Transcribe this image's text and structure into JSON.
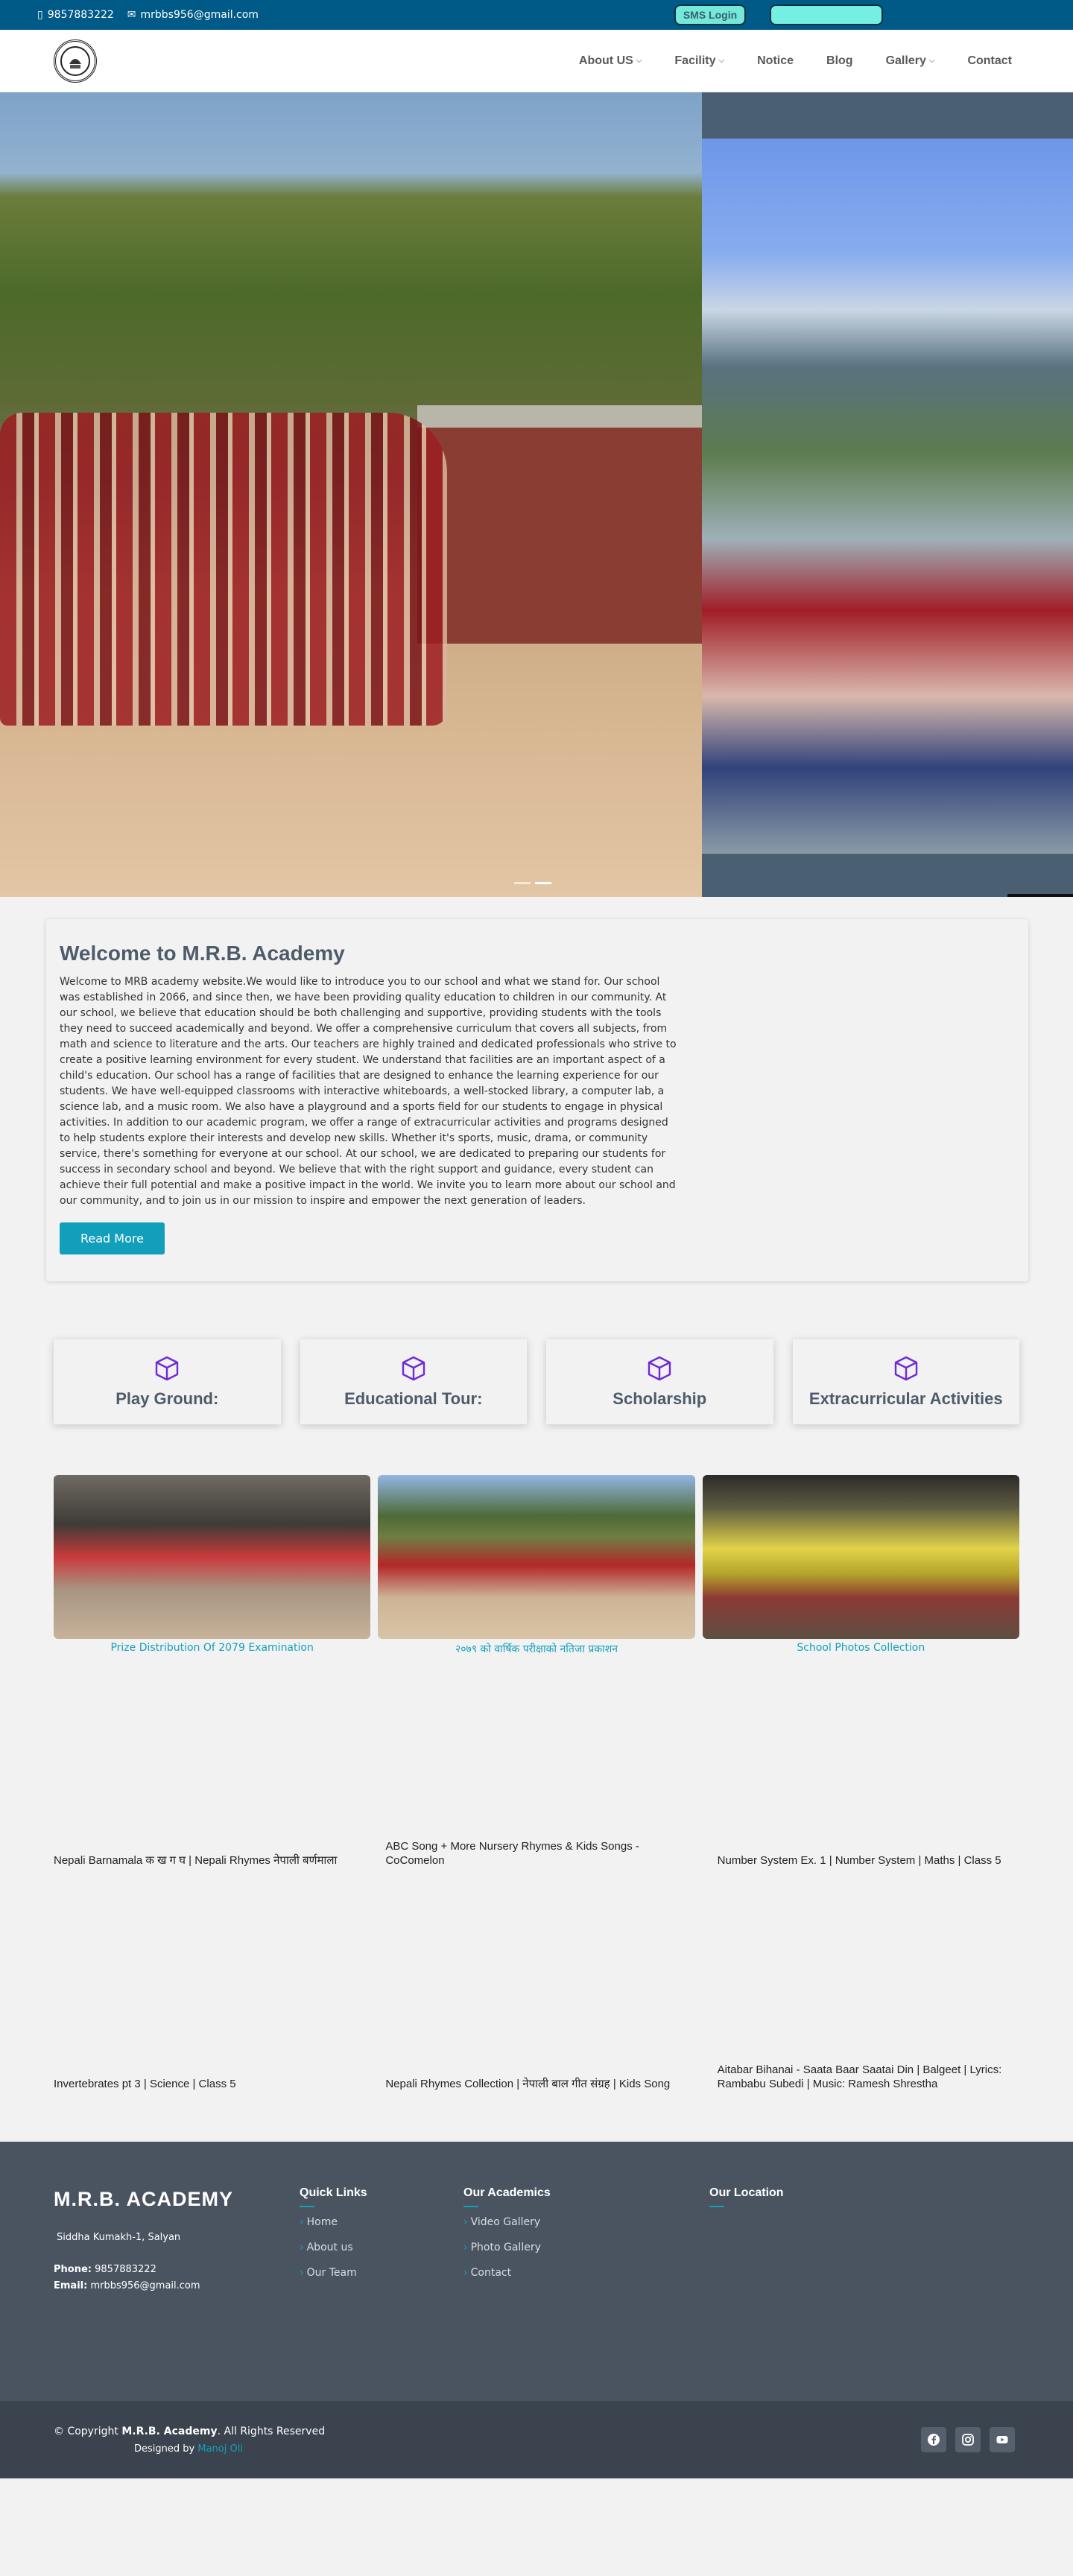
{
  "topbar": {
    "phone": "9857883222",
    "email": "mrbbs956@gmail.com",
    "sms_login": "SMS Login"
  },
  "nav": {
    "items": [
      {
        "label": "About US",
        "dropdown": true
      },
      {
        "label": "Facility",
        "dropdown": true
      },
      {
        "label": "Notice",
        "dropdown": false
      },
      {
        "label": "Blog",
        "dropdown": false
      },
      {
        "label": "Gallery",
        "dropdown": true
      },
      {
        "label": "Contact",
        "dropdown": false
      }
    ]
  },
  "welcome": {
    "title": "Welcome to M.R.B. Academy",
    "body": "Welcome to MRB academy website.We would like to introduce you to our school and what we stand for. Our school was established in 2066, and since then, we have been providing quality education to children in our community. At our school, we believe that education should be both challenging and supportive, providing students with the tools they need to succeed academically and beyond. We offer a comprehensive curriculum that covers all subjects, from math and science to literature and the arts. Our teachers are highly trained and dedicated professionals who strive to create a positive learning environment for every student. We understand that facilities are an important aspect of a child's education. Our school has a range of facilities that are designed to enhance the learning experience for our students. We have well-equipped classrooms with interactive whiteboards, a well-stocked library, a computer lab, a science lab, and a music room. We also have a playground and a sports field for our students to engage in physical activities. In addition to our academic program, we offer a range of extracurricular activities and programs designed to help students explore their interests and develop new skills. Whether it's sports, music, drama, or community service, there's something for everyone at our school. At our school, we are dedicated to preparing our students for success in secondary school and beyond. We believe that with the right support and guidance, every student can achieve their full potential and make a positive impact in the world. We invite you to learn more about our school and our community, and to join us in our mission to inspire and empower the next generation of leaders.",
    "read_more": "Read More"
  },
  "features": [
    {
      "label": "Play Ground:",
      "icon": "cube-icon"
    },
    {
      "label": "Educational Tour:",
      "icon": "cube-icon"
    },
    {
      "label": "Scholarship",
      "icon": "cube-icon"
    },
    {
      "label": "Extracurricular Activities",
      "icon": "cube-icon"
    }
  ],
  "gallery": [
    {
      "caption": "Prize Distribution Of 2079 Examination"
    },
    {
      "caption": "२०७९ को वार्षिक परीक्षाको नतिजा प्रकाशन"
    },
    {
      "caption": "School Photos Collection"
    }
  ],
  "videos": [
    {
      "title": "Nepali Barnamala क ख ग घ | Nepali Rhymes नेपाली बर्णमाला"
    },
    {
      "title": "ABC Song + More Nursery Rhymes & Kids Songs - CoComelon"
    },
    {
      "title": "Number System Ex. 1 | Number System | Maths | Class 5"
    },
    {
      "title": "Invertebrates pt 3 | Science | Class 5"
    },
    {
      "title": "Nepali Rhymes Collection | नेपाली बाल गीत संग्रह | Kids Song"
    },
    {
      "title": "Aitabar Bihanai - Saata Baar Saatai Din | Balgeet | Lyrics: Rambabu Subedi | Music: Ramesh Shrestha"
    }
  ],
  "footer": {
    "brand": "M.R.B. ACADEMY",
    "address": "Siddha Kumakh-1, Salyan",
    "phone_label": "Phone:",
    "phone": "9857883222",
    "email_label": "Email:",
    "email": "mrbbs956@gmail.com",
    "quick_links_title": "Quick Links",
    "quick_links": [
      "Home",
      "About us",
      "Our Team"
    ],
    "academics_title": "Our Academics",
    "academics": [
      "Video Gallery",
      "Photo Gallery",
      "Contact"
    ],
    "location_title": "Our Location"
  },
  "bottom": {
    "copyright_prefix": "© Copyright",
    "copyright_name": "M.R.B. Academy",
    "copyright_suffix": ". All Rights Reserved",
    "designed_by": "Designed by",
    "designer": "Manoj Oli"
  },
  "colors": {
    "topbar": "#005a87",
    "accent": "#129fbc",
    "icon_purple": "#6f2bd8",
    "footer": "#4a5461",
    "bottom": "#3b434e"
  }
}
